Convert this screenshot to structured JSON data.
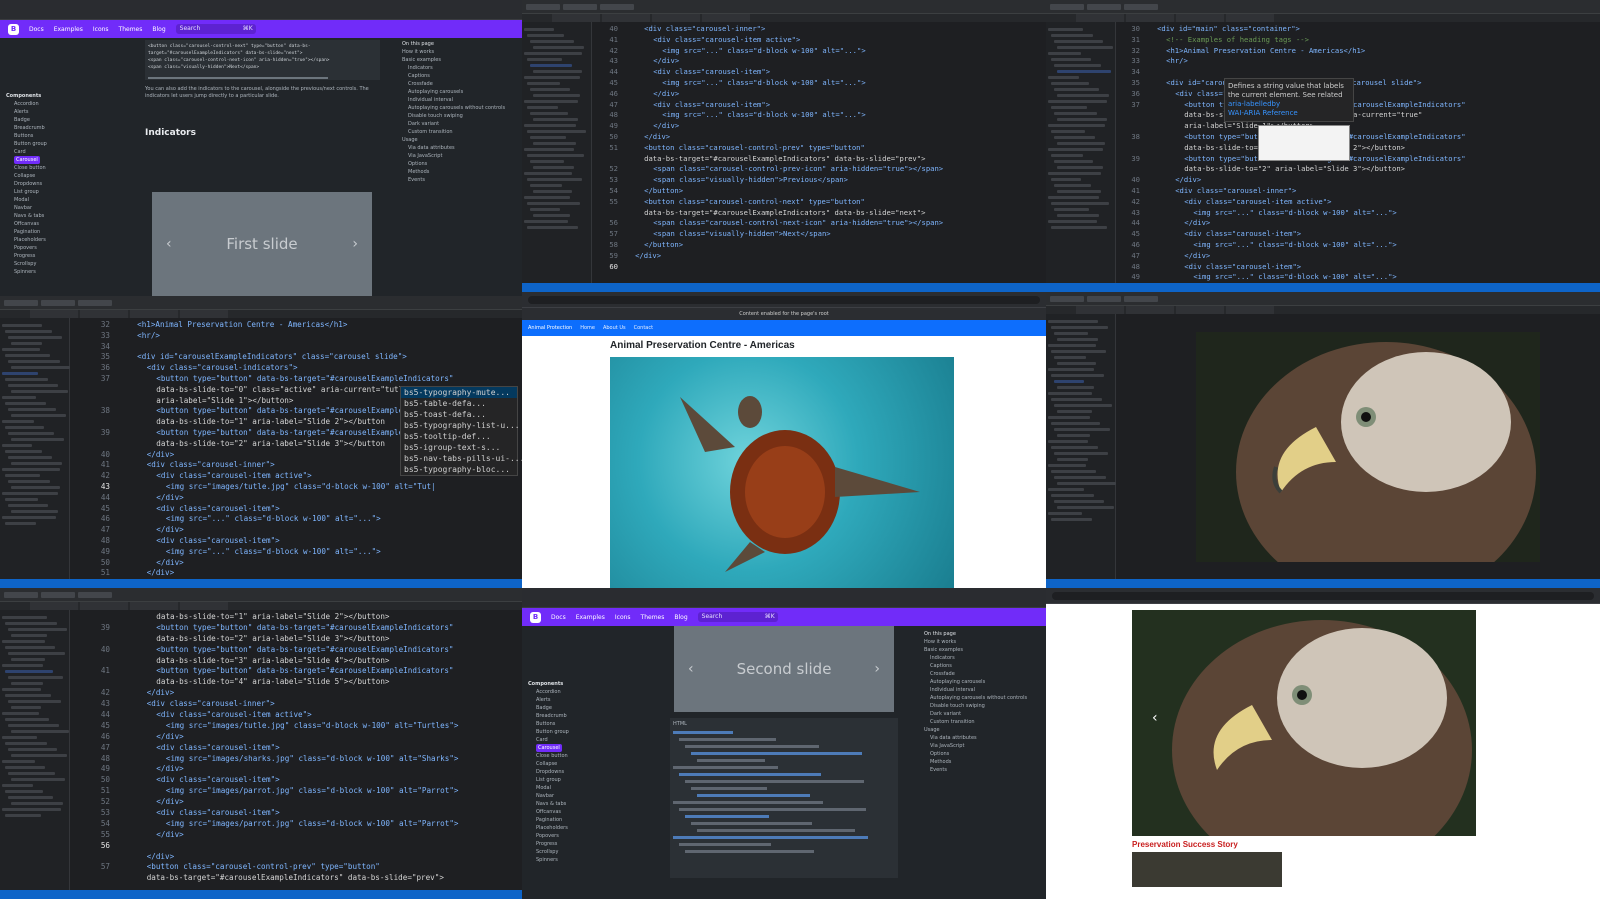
{
  "tiles": {
    "docs_top": {
      "nav": {
        "items": [
          "Docs",
          "Examples",
          "Icons",
          "Themes",
          "Blog"
        ],
        "search_placeholder": "Search",
        "search_shortcut": "⌘K"
      },
      "code_snippet": [
        "<button class=\"carousel-control-next\" type=\"button\" data-bs-target=\"#carouselExampleIndicators\" data-bs-slide=\"next\">",
        "<span class=\"carousel-control-next-icon\" aria-hidden=\"true\"></span>",
        "<span class=\"visually-hidden\">Next</span>"
      ],
      "paragraph1": "You can also add the indicators to the carousel, alongside the previous/next controls. The indicators let users jump directly to a particular slide.",
      "heading": "Indicators",
      "slide_label": "First slide",
      "prev": "‹",
      "next": "›",
      "sidebar_heading": "Components",
      "sidebar_items": [
        "Accordion",
        "Alerts",
        "Badge",
        "Breadcrumb",
        "Buttons",
        "Button group",
        "Card",
        "Carousel",
        "Close button",
        "Collapse",
        "Dropdowns",
        "List group",
        "Modal",
        "Navbar",
        "Navs & tabs",
        "Offcanvas",
        "Pagination",
        "Placeholders",
        "Popovers",
        "Progress",
        "Scrollspy",
        "Spinners"
      ],
      "toc_heading": "On this page",
      "toc_items": [
        "How it works",
        "Basic examples",
        "Indicators",
        "Captions",
        "Crossfade",
        "Autoplaying carousels",
        "Individual interval",
        "Autoplaying carousels without controls",
        "Disable touch swiping",
        "Dark variant",
        "Custom transition",
        "Usage",
        "Via data attributes",
        "Via JavaScript",
        "Options",
        "Methods",
        "Events"
      ]
    },
    "code_a": {
      "lines": [
        {
          "n": "40",
          "t": "<div class=\"carousel-inner\">",
          "ind": 2
        },
        {
          "n": "41",
          "t": "<div class=\"carousel-item active\">",
          "ind": 3
        },
        {
          "n": "42",
          "t": "<img src=\"...\" class=\"d-block w-100\" alt=\"...\">",
          "ind": 4
        },
        {
          "n": "43",
          "t": "</div>",
          "ind": 3
        },
        {
          "n": "44",
          "t": "<div class=\"carousel-item\">",
          "ind": 3
        },
        {
          "n": "45",
          "t": "<img src=\"...\" class=\"d-block w-100\" alt=\"...\">",
          "ind": 4
        },
        {
          "n": "46",
          "t": "</div>",
          "ind": 3
        },
        {
          "n": "47",
          "t": "<div class=\"carousel-item\">",
          "ind": 3
        },
        {
          "n": "48",
          "t": "<img src=\"...\" class=\"d-block w-100\" alt=\"...\">",
          "ind": 4
        },
        {
          "n": "49",
          "t": "</div>",
          "ind": 3
        },
        {
          "n": "50",
          "t": "</div>",
          "ind": 2
        },
        {
          "n": "51",
          "t": "<button class=\"carousel-control-prev\" type=\"button\"",
          "ind": 2
        },
        {
          "n": "",
          "t": "data-bs-target=\"#carouselExampleIndicators\" data-bs-slide=\"prev\">",
          "ind": 2
        },
        {
          "n": "52",
          "t": "<span class=\"carousel-control-prev-icon\" aria-hidden=\"true\"></span>",
          "ind": 3
        },
        {
          "n": "53",
          "t": "<span class=\"visually-hidden\">Previous</span>",
          "ind": 3
        },
        {
          "n": "54",
          "t": "</button>",
          "ind": 2
        },
        {
          "n": "55",
          "t": "<button class=\"carousel-control-next\" type=\"button\"",
          "ind": 2
        },
        {
          "n": "",
          "t": "data-bs-target=\"#carouselExampleIndicators\" data-bs-slide=\"next\">",
          "ind": 2
        },
        {
          "n": "56",
          "t": "<span class=\"carousel-control-next-icon\" aria-hidden=\"true\"></span>",
          "ind": 3
        },
        {
          "n": "57",
          "t": "<span class=\"visually-hidden\">Next</span>",
          "ind": 3
        },
        {
          "n": "58",
          "t": "</button>",
          "ind": 2
        },
        {
          "n": "59",
          "t": "</div>",
          "ind": 1
        },
        {
          "n": "60",
          "t": "",
          "ind": 0,
          "cur": true
        }
      ]
    },
    "code_b": {
      "lines": [
        {
          "n": "30",
          "t": "<div id=\"main\" class=\"container\">",
          "ind": 1
        },
        {
          "n": "31",
          "t": "<!-- Examples of heading tags -->",
          "ind": 2
        },
        {
          "n": "32",
          "t": "<h1>Animal Preservation Centre - Americas</h1>",
          "ind": 2
        },
        {
          "n": "33",
          "t": "<hr/>",
          "ind": 2
        },
        {
          "n": "34",
          "t": "",
          "ind": 0
        },
        {
          "n": "35",
          "t": "<div id=\"carouselExampleIndicators\" class=\"carousel slide\">",
          "ind": 2
        },
        {
          "n": "36",
          "t": "<div class=\"carousel-indicators\">",
          "ind": 3
        },
        {
          "n": "37",
          "t": "<button type=\"button\" data-bs-target=\"#carouselExampleIndicators\"",
          "ind": 4
        },
        {
          "n": "",
          "t": "data-bs-slide-to=\"0\" class=\"active\" aria-current=\"true\"",
          "ind": 4
        },
        {
          "n": "",
          "t": "aria-label=\"Slide 1\"></button>",
          "ind": 4
        },
        {
          "n": "38",
          "t": "<button type=\"button\" data-bs-target=\"#carouselExampleIndicators\"",
          "ind": 4
        },
        {
          "n": "",
          "t": "data-bs-slide-to=\"1\" aria-label=\"Slide 2\"></button>",
          "ind": 4
        },
        {
          "n": "39",
          "t": "<button type=\"button\" data-bs-target=\"#carouselExampleIndicators\"",
          "ind": 4
        },
        {
          "n": "",
          "t": "data-bs-slide-to=\"2\" aria-label=\"Slide 3\"></button>",
          "ind": 4
        },
        {
          "n": "40",
          "t": "</div>",
          "ind": 3
        },
        {
          "n": "41",
          "t": "<div class=\"carousel-inner\">",
          "ind": 3
        },
        {
          "n": "42",
          "t": "<div class=\"carousel-item active\">",
          "ind": 4
        },
        {
          "n": "43",
          "t": "<img src=\"...\" class=\"d-block w-100\" alt=\"...\">",
          "ind": 5
        },
        {
          "n": "44",
          "t": "</div>",
          "ind": 4
        },
        {
          "n": "45",
          "t": "<div class=\"carousel-item\">",
          "ind": 4
        },
        {
          "n": "46",
          "t": "<img src=\"...\" class=\"d-block w-100\" alt=\"...\">",
          "ind": 5
        },
        {
          "n": "47",
          "t": "</div>",
          "ind": 4
        },
        {
          "n": "48",
          "t": "<div class=\"carousel-item\">",
          "ind": 4
        },
        {
          "n": "49",
          "t": "<img src=\"...\" class=\"d-block w-100\" alt=\"...\">",
          "ind": 5
        }
      ],
      "tooltip": {
        "text": "Defines a string value that labels the current element. See related",
        "link1": "aria-labelledby",
        "link2": "WAI-ARIA Reference"
      }
    },
    "code_c": {
      "lines": [
        {
          "n": "32",
          "t": "<h1>Animal Preservation Centre - Americas</h1>",
          "ind": 2
        },
        {
          "n": "33",
          "t": "<hr/>",
          "ind": 2
        },
        {
          "n": "34",
          "t": "",
          "ind": 0
        },
        {
          "n": "35",
          "t": "<div id=\"carouselExampleIndicators\" class=\"carousel slide\">",
          "ind": 2
        },
        {
          "n": "36",
          "t": "<div class=\"carousel-indicators\">",
          "ind": 3
        },
        {
          "n": "37",
          "t": "<button type=\"button\" data-bs-target=\"#carouselExampleIndicators\"",
          "ind": 4
        },
        {
          "n": "",
          "t": "data-bs-slide-to=\"0\" class=\"active\" aria-current=\"tutle",
          "ind": 4
        },
        {
          "n": "",
          "t": "aria-label=\"Slide 1\"></button>",
          "ind": 4
        },
        {
          "n": "38",
          "t": "<button type=\"button\" data-bs-target=\"#carouselExampleIndicators",
          "ind": 4
        },
        {
          "n": "",
          "t": "data-bs-slide-to=\"1\" aria-label=\"Slide 2\"></button",
          "ind": 4
        },
        {
          "n": "39",
          "t": "<button type=\"button\" data-bs-target=\"#carouselExampleIndicators",
          "ind": 4
        },
        {
          "n": "",
          "t": "data-bs-slide-to=\"2\" aria-label=\"Slide 3\"></button",
          "ind": 4
        },
        {
          "n": "40",
          "t": "</div>",
          "ind": 3
        },
        {
          "n": "41",
          "t": "<div class=\"carousel-inner\">",
          "ind": 3
        },
        {
          "n": "42",
          "t": "<div class=\"carousel-item active\">",
          "ind": 4
        },
        {
          "n": "43",
          "t": "<img src=\"images/tutle.jpg\" class=\"d-block w-100\" alt=\"Tut|",
          "ind": 5,
          "cur": true
        },
        {
          "n": "44",
          "t": "</div>",
          "ind": 4
        },
        {
          "n": "45",
          "t": "<div class=\"carousel-item\">",
          "ind": 4
        },
        {
          "n": "46",
          "t": "<img src=\"...\" class=\"d-block w-100\" alt=\"...\">",
          "ind": 5
        },
        {
          "n": "47",
          "t": "</div>",
          "ind": 4
        },
        {
          "n": "48",
          "t": "<div class=\"carousel-item\">",
          "ind": 4
        },
        {
          "n": "49",
          "t": "<img src=\"...\" class=\"d-block w-100\" alt=\"...\">",
          "ind": 5
        },
        {
          "n": "50",
          "t": "</div>",
          "ind": 4
        },
        {
          "n": "51",
          "t": "</div>",
          "ind": 3
        }
      ],
      "autocomplete": [
        "bs5-typography-mute...",
        "bs5-table-defa...",
        "bs5-toast-defa...",
        "bs5-typography-list-u...",
        "bs5-tooltip-def...",
        "bs5-igroup-text-s...",
        "bs5-nav-tabs-pills-ui-...",
        "bs5-typography-bloc..."
      ]
    },
    "browser_turtle": {
      "banner": "Content enabled for the page's root",
      "nav_items": [
        "Animal Protection",
        "Home",
        "About Us",
        "Contact"
      ],
      "title": "Animal Preservation Centre - Americas"
    },
    "editor_eagle": {},
    "code_d": {
      "lines": [
        {
          "n": "",
          "t": "data-bs-slide-to=\"1\" aria-label=\"Slide 2\"></button>",
          "ind": 4
        },
        {
          "n": "39",
          "t": "<button type=\"button\" data-bs-target=\"#carouselExampleIndicators\"",
          "ind": 4
        },
        {
          "n": "",
          "t": "data-bs-slide-to=\"2\" aria-label=\"Slide 3\"></button>",
          "ind": 4
        },
        {
          "n": "40",
          "t": "<button type=\"button\" data-bs-target=\"#carouselExampleIndicators\"",
          "ind": 4
        },
        {
          "n": "",
          "t": "data-bs-slide-to=\"3\" aria-label=\"Slide 4\"></button>",
          "ind": 4
        },
        {
          "n": "41",
          "t": "<button type=\"button\" data-bs-target=\"#carouselExampleIndicators\"",
          "ind": 4
        },
        {
          "n": "",
          "t": "data-bs-slide-to=\"4\" aria-label=\"Slide 5\"></button>",
          "ind": 4
        },
        {
          "n": "42",
          "t": "</div>",
          "ind": 3
        },
        {
          "n": "43",
          "t": "<div class=\"carousel-inner\">",
          "ind": 3
        },
        {
          "n": "44",
          "t": "<div class=\"carousel-item active\">",
          "ind": 4
        },
        {
          "n": "45",
          "t": "<img src=\"images/tutle.jpg\" class=\"d-block w-100\" alt=\"Turtles\">",
          "ind": 5
        },
        {
          "n": "46",
          "t": "</div>",
          "ind": 4
        },
        {
          "n": "47",
          "t": "<div class=\"carousel-item\">",
          "ind": 4
        },
        {
          "n": "48",
          "t": "<img src=\"images/sharks.jpg\" class=\"d-block w-100\" alt=\"Sharks\">",
          "ind": 5
        },
        {
          "n": "49",
          "t": "</div>",
          "ind": 4
        },
        {
          "n": "50",
          "t": "<div class=\"carousel-item\">",
          "ind": 4
        },
        {
          "n": "51",
          "t": "<img src=\"images/parrot.jpg\" class=\"d-block w-100\" alt=\"Parrot\">",
          "ind": 5
        },
        {
          "n": "52",
          "t": "</div>",
          "ind": 4
        },
        {
          "n": "53",
          "t": "<div class=\"carousel-item\">",
          "ind": 4
        },
        {
          "n": "54",
          "t": "<img src=\"images/parrot.jpg\" class=\"d-block w-100\" alt=\"Parrot\">",
          "ind": 5
        },
        {
          "n": "55",
          "t": "</div>",
          "ind": 4
        },
        {
          "n": "56",
          "t": "",
          "ind": 0,
          "cur": true
        },
        {
          "n": "",
          "t": "</div>",
          "ind": 3
        },
        {
          "n": "57",
          "t": "<button class=\"carousel-control-prev\" type=\"button\"",
          "ind": 3
        },
        {
          "n": "",
          "t": "data-bs-target=\"#carouselExampleIndicators\" data-bs-slide=\"prev\">",
          "ind": 3
        }
      ]
    },
    "docs_bottom": {
      "nav": {
        "items": [
          "Docs",
          "Examples",
          "Icons",
          "Themes",
          "Blog"
        ],
        "search_placeholder": "Search",
        "search_shortcut": "⌘K"
      },
      "slide_label": "Second slide",
      "prev": "‹",
      "next": "›",
      "sidebar_heading": "Components",
      "sidebar_items": [
        "Accordion",
        "Alerts",
        "Badge",
        "Breadcrumb",
        "Buttons",
        "Button group",
        "Card",
        "Carousel",
        "Close button",
        "Collapse",
        "Dropdowns",
        "List group",
        "Modal",
        "Navbar",
        "Navs & tabs",
        "Offcanvas",
        "Pagination",
        "Placeholders",
        "Popovers",
        "Progress",
        "Scrollspy",
        "Spinners"
      ],
      "code_label": "HTML",
      "toc_heading": "On this page",
      "toc_items": [
        "How it works",
        "Basic examples",
        "Indicators",
        "Captions",
        "Crossfade",
        "Autoplaying carousels",
        "Individual interval",
        "Autoplaying carousels without controls",
        "Disable touch swiping",
        "Dark variant",
        "Custom transition",
        "Usage",
        "Via data attributes",
        "Via JavaScript",
        "Options",
        "Methods",
        "Events"
      ]
    },
    "browser_eagle": {
      "section_title": "Preservation Success Story"
    }
  },
  "colors": {
    "bootstrap_purple": "#712cf9",
    "vscode_status": "#0e64c8",
    "page_nav_blue": "#0d6efd",
    "section_title_red": "#c81e1e"
  }
}
